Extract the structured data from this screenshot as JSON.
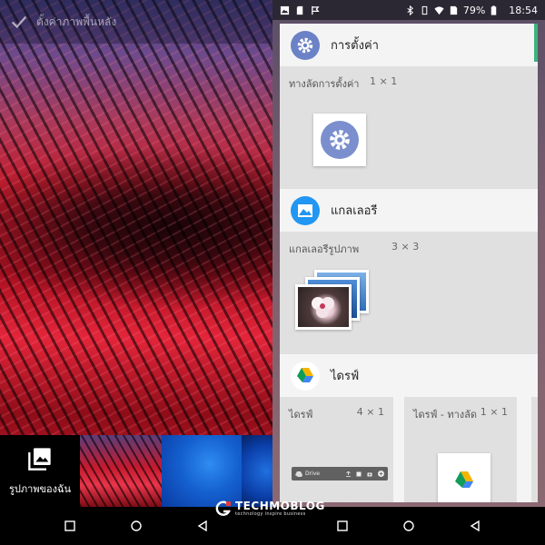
{
  "left": {
    "topbar": {
      "title": "ตั้งค่าภาพพื้นหลัง",
      "icon": "check-icon"
    },
    "tray": {
      "my_pictures_label": "รูปภาพของฉัน",
      "icon": "pictures-icon"
    }
  },
  "right": {
    "status": {
      "battery": "79%",
      "time": "18:54"
    },
    "apps": [
      {
        "name": "การตั้งค่า",
        "icon": "settings-icon",
        "widgets": [
          {
            "label": "ทางลัดการตั้งค่า",
            "size": "1 × 1"
          }
        ]
      },
      {
        "name": "แกลเลอรี",
        "icon": "gallery-icon",
        "widgets": [
          {
            "label": "แกลเลอรีรูปภาพ",
            "size": "3 × 3"
          }
        ]
      },
      {
        "name": "ไดรฟ์",
        "icon": "drive-icon",
        "widgets": [
          {
            "label": "ไดรฟ์",
            "size": "4 × 1",
            "preview_text": "Drive"
          },
          {
            "label": "ไดรฟ์ - ทางลัด",
            "size": "1 × 1"
          }
        ]
      }
    ]
  },
  "watermark": {
    "title": "TECHMOBLOG",
    "subtitle": "technology inspire business"
  },
  "colors": {
    "accent": "#3db37e",
    "settings_blue": "#6b82c6"
  }
}
